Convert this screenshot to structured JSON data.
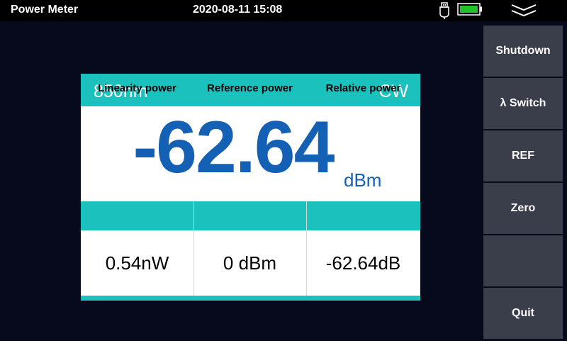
{
  "topbar": {
    "app_title": "Power Meter",
    "datetime": "2020-08-11 15:08",
    "icons": [
      "usb-icon",
      "battery-icon",
      "chevron-double-down-icon"
    ],
    "battery_color": "#22c32a"
  },
  "sidebar": {
    "buttons": [
      {
        "label": "Shutdown"
      },
      {
        "label": "λ Switch"
      },
      {
        "label": "REF"
      },
      {
        "label": "Zero"
      },
      {
        "label": ""
      },
      {
        "label": "Quit"
      }
    ]
  },
  "meter": {
    "wavelength": "850nm",
    "mode": "CW",
    "power_value": "-62.64",
    "power_unit": "dBm",
    "stats": {
      "headers": [
        "Linearity power",
        "Reference power",
        "Relative power"
      ],
      "values": [
        "0.54nW",
        "0 dBm",
        "-62.64dB"
      ]
    }
  },
  "colors": {
    "accent": "#1bc2bd",
    "value_blue": "#1360b4",
    "background": "#070a1c",
    "button_gray": "#3a3e4b"
  }
}
